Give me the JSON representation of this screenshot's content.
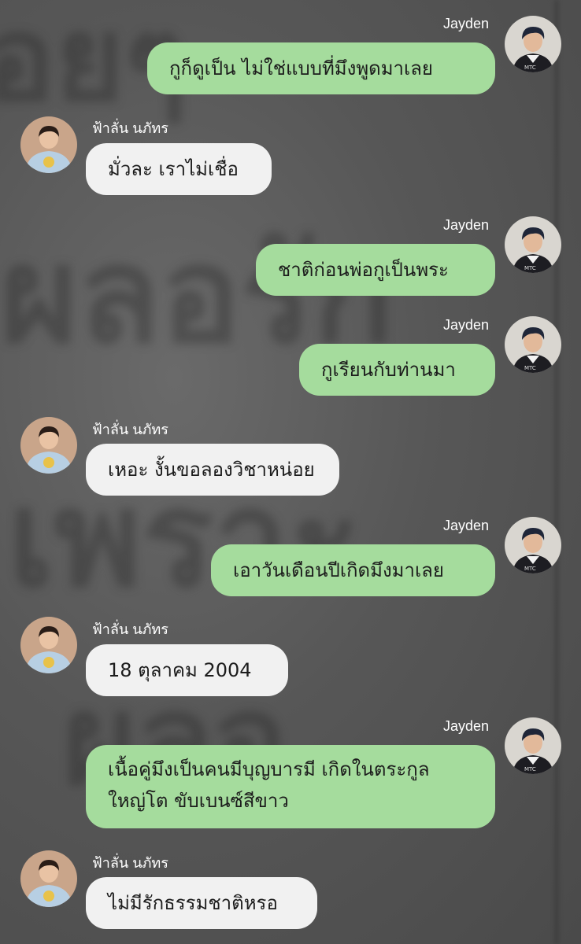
{
  "conversation": {
    "participants": {
      "me": "Jayden",
      "other": "ฟ้าลั่น นภัทร"
    },
    "messages": [
      {
        "sender": "Jayden",
        "side": "right",
        "text": "กูก็ดูเป็น ไม่ใช่แบบที่มึงพูดมาเลย"
      },
      {
        "sender": "ฟ้าลั่น นภัทร",
        "side": "left",
        "text": "มั่วละ เราไม่เชื่อ"
      },
      {
        "sender": "Jayden",
        "side": "right",
        "text": "ชาติก่อนพ่อกูเป็นพระ"
      },
      {
        "sender": "Jayden",
        "side": "right",
        "text": "กูเรียนกับท่านมา"
      },
      {
        "sender": "ฟ้าลั่น นภัทร",
        "side": "left",
        "text": "เหอะ งั้นขอลองวิชาหน่อย"
      },
      {
        "sender": "Jayden",
        "side": "right",
        "text": "เอาวันเดือนปีเกิดมึงมาเลย"
      },
      {
        "sender": "ฟ้าลั่น นภัทร",
        "side": "left",
        "text": "18 ตุลาคม 2004"
      },
      {
        "sender": "Jayden",
        "side": "right",
        "lines": [
          "เนื้อคู่มึงเป็นคนมีบุญบารมี เกิดในตระกูล",
          "ใหญ่โต ขับเบนซ์สีขาว"
        ]
      },
      {
        "sender": "ฟ้าลั่น นภัทร",
        "side": "left",
        "text": "ไม่มีรักธรรมชาติหรอ"
      }
    ]
  },
  "colors": {
    "sent_bubble": "#a5dc9d",
    "received_bubble": "#f1f1f1",
    "name_text": "#ffffff",
    "background": "#5b5b5b"
  },
  "icons": {
    "sender_avatar": "jayden-avatar-icon",
    "receiver_avatar": "falan-avatar-icon"
  }
}
